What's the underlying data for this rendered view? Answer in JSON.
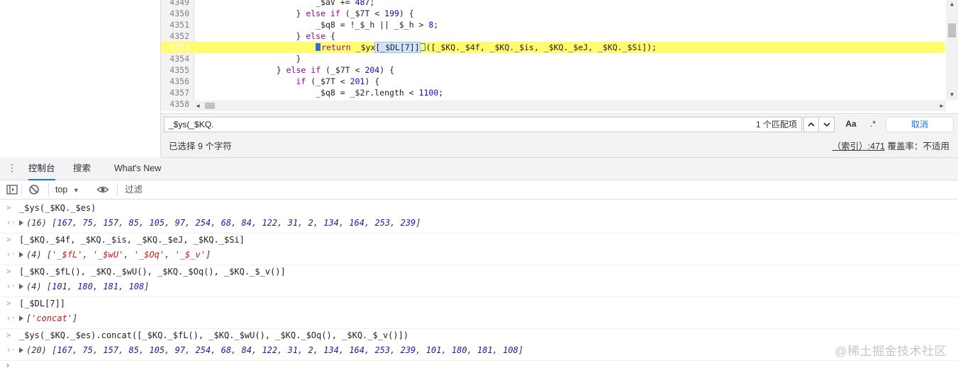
{
  "editor": {
    "lines": [
      {
        "num": "4349",
        "text": "                        _$aV += 487;"
      },
      {
        "num": "4350",
        "text": "                    } else if (_$7T < 199) {"
      },
      {
        "num": "4351",
        "text": "                        _$q8 = !_$_h || _$_h > 8;"
      },
      {
        "num": "4352",
        "text": "                    } else {"
      },
      {
        "num": "4354",
        "text": "                    }"
      },
      {
        "num": "4355",
        "text": "                } else if (_$7T < 204) {"
      },
      {
        "num": "4356",
        "text": "                    if (_$7T < 201) {"
      },
      {
        "num": "4357",
        "text": "                        _$q8 = _$2r.length < 1100;"
      },
      {
        "num": "4358",
        "text": ""
      }
    ],
    "paused_line": {
      "num": "4353",
      "indent": "                        ",
      "keyword": "return",
      "before_selection": " _$yx",
      "selection": "[_$DL[7]]",
      "after_selection": "([_$KQ._$4f, _$KQ._$is, _$KQ._$eJ, _$KQ._$Si]);"
    }
  },
  "search": {
    "query": "_$ys(_$KQ.",
    "match_count": "1 个匹配项",
    "case_label": "Aa",
    "regex_label": ".*",
    "cancel_label": "取消"
  },
  "status": {
    "selection_info": "已选择 9 个字符",
    "position": "（索引）:471",
    "coverage": "覆盖率：不适用"
  },
  "drawer": {
    "tabs": [
      "控制台",
      "搜索",
      "What's New"
    ]
  },
  "toolbar": {
    "context": "top",
    "filter_placeholder": "过滤"
  },
  "console": {
    "entries": [
      {
        "input": "_$ys(_$KQ._$es)",
        "result_count": "(16)",
        "result_type": "numbers",
        "values": [
          "167",
          "75",
          "157",
          "85",
          "105",
          "97",
          "254",
          "68",
          "84",
          "122",
          "31",
          "2",
          "134",
          "164",
          "253",
          "239"
        ]
      },
      {
        "input": "[_$KQ._$4f, _$KQ._$is, _$KQ._$eJ, _$KQ._$Si]",
        "result_count": "(4)",
        "result_type": "strings",
        "values": [
          "'_$fL'",
          "'_$wU'",
          "'_$Oq'",
          "'_$_v'"
        ]
      },
      {
        "input": "[_$KQ._$fL(), _$KQ._$wU(), _$KQ._$Oq(), _$KQ._$_v()]",
        "result_count": "(4)",
        "result_type": "numbers",
        "values": [
          "101",
          "180",
          "181",
          "108"
        ]
      },
      {
        "input": "[_$DL[7]]",
        "result_count": "",
        "result_type": "strings",
        "values": [
          "'concat'"
        ]
      },
      {
        "input": "_$ys(_$KQ._$es).concat([_$KQ._$fL(), _$KQ._$wU(), _$KQ._$Oq(), _$KQ._$_v()])",
        "result_count": "(20)",
        "result_type": "numbers",
        "values": [
          "167",
          "75",
          "157",
          "85",
          "105",
          "97",
          "254",
          "68",
          "84",
          "122",
          "31",
          "2",
          "134",
          "164",
          "253",
          "239",
          "101",
          "180",
          "181",
          "108"
        ]
      }
    ]
  },
  "watermark": "@稀土掘金技术社区"
}
